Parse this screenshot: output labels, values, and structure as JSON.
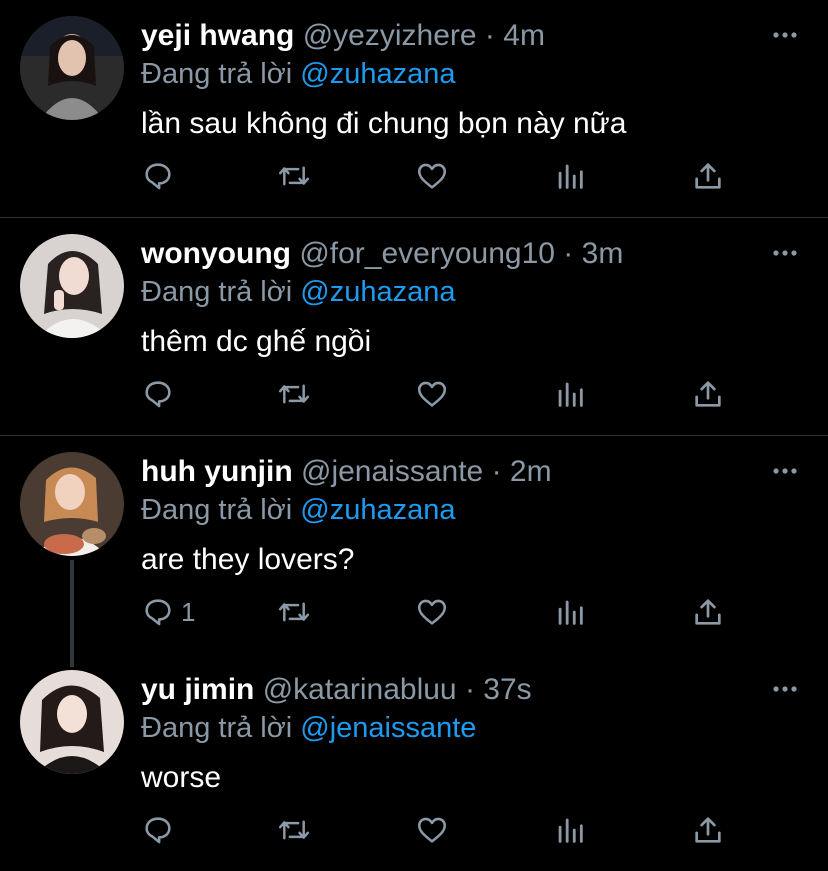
{
  "replying_prefix": "Đang trả lời ",
  "tweets": [
    {
      "name": "yeji hwang",
      "handle": "@yezyizhere",
      "time": "4m",
      "reply_to": "@zuhazana",
      "text": "lần sau không đi chung bọn này nữa",
      "reply_count": "",
      "avatar_color": "#6b6b6b"
    },
    {
      "name": "wonyoung",
      "handle": "@for_everyoung10",
      "time": "3m",
      "reply_to": "@zuhazana",
      "text": "thêm dc ghế ngồi",
      "reply_count": "",
      "avatar_color": "#cfc8c6"
    },
    {
      "name": "huh yunjin",
      "handle": "@jenaissante",
      "time": "2m",
      "reply_to": "@zuhazana",
      "text": "are they lovers?",
      "reply_count": "1",
      "avatar_color": "#8a6a55"
    },
    {
      "name": "yu jimin",
      "handle": "@katarinabluu",
      "time": "37s",
      "reply_to": "@jenaissante",
      "text": "worse",
      "reply_count": "",
      "avatar_color": "#d9cfc9"
    }
  ],
  "separator": "·",
  "colors": {
    "background": "#000000",
    "link": "#1d9bf0",
    "muted": "#8b98a5",
    "text": "#ffffff"
  }
}
